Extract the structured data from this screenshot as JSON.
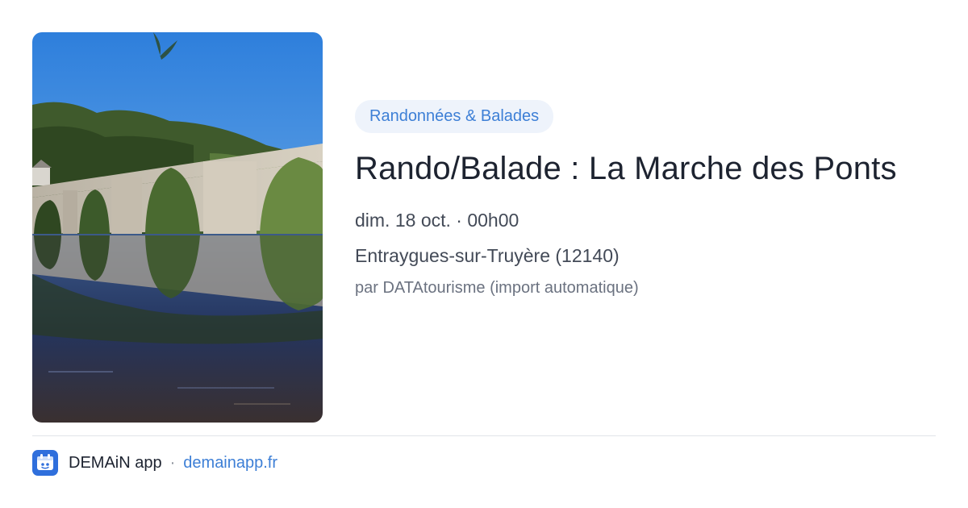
{
  "card": {
    "image": {
      "alt": "Pont médiéval en arches se reflétant dans la rivière",
      "colors": {
        "sky": "#3b86d9",
        "water": "#1e2f5a",
        "stone": "#c9c2b3",
        "forest": "#3f5a2c"
      }
    },
    "category_tag": "Randonnées & Balades",
    "title": "Rando/Balade : La Marche des Ponts",
    "date": "dim. 18 oct. · 00h00",
    "location": "Entraygues-sur-Truyère (12140)",
    "author": "par DATAtourisme (import automatique)"
  },
  "footer": {
    "logo_icon": "demain-app-logo-icon",
    "app_name": "DEMAiN app",
    "separator": "·",
    "domain": "demainapp.fr"
  },
  "colors": {
    "accent": "#3d7fd6",
    "tag_background": "#eef3fb",
    "title": "#1d2330",
    "muted": "#6b7280"
  }
}
